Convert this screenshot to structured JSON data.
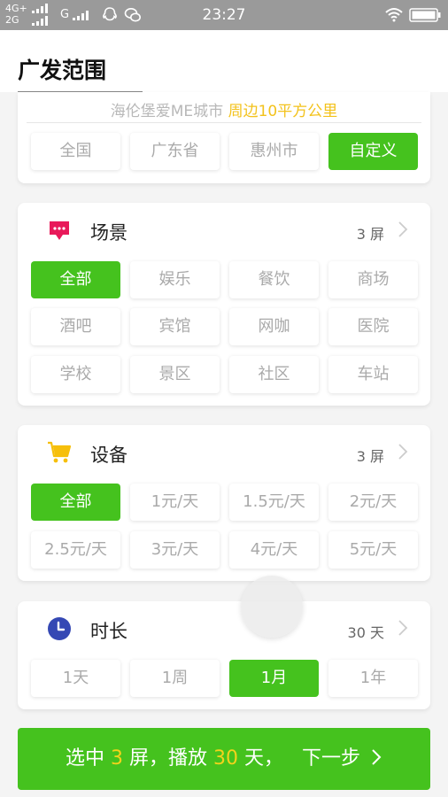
{
  "status_bar": {
    "network_1": "4G+",
    "network_2": "2G",
    "network_3": "G",
    "time": "23:27",
    "icons": [
      "qq-icon",
      "wechat-icon",
      "wifi-icon",
      "battery-icon"
    ]
  },
  "page": {
    "title": "广发范围"
  },
  "region": {
    "location_name": "海伦堡爱ME城市",
    "range_text": "周边10平方公里",
    "options": [
      "全国",
      "广东省",
      "惠州市",
      "自定义"
    ],
    "selected_index": 3
  },
  "scene": {
    "label": "场景",
    "count": "3 屏",
    "icon": "chat-bubble-icon",
    "options": [
      "全部",
      "娱乐",
      "餐饮",
      "商场",
      "酒吧",
      "宾馆",
      "网咖",
      "医院",
      "学校",
      "景区",
      "社区",
      "车站"
    ],
    "selected_index": 0
  },
  "device": {
    "label": "设备",
    "count": "3 屏",
    "icon": "cart-icon",
    "options": [
      "全部",
      "1元/天",
      "1.5元/天",
      "2元/天",
      "2.5元/天",
      "3元/天",
      "4元/天",
      "5元/天"
    ],
    "selected_index": 0
  },
  "duration": {
    "label": "时长",
    "count": "30 天",
    "icon": "clock-icon",
    "options": [
      "1天",
      "1周",
      "1月",
      "1年"
    ],
    "selected_index": 2
  },
  "footer": {
    "prefix": "选中",
    "screens": "3",
    "mid": "屏，播放",
    "days": "30",
    "suffix": "天，",
    "next": "下一步"
  },
  "colors": {
    "accent": "#45c21e",
    "highlight": "#f3c21b",
    "scene_icon": "#e8195a",
    "device_icon": "#f6bf0b",
    "clock_icon": "#3548b4"
  }
}
